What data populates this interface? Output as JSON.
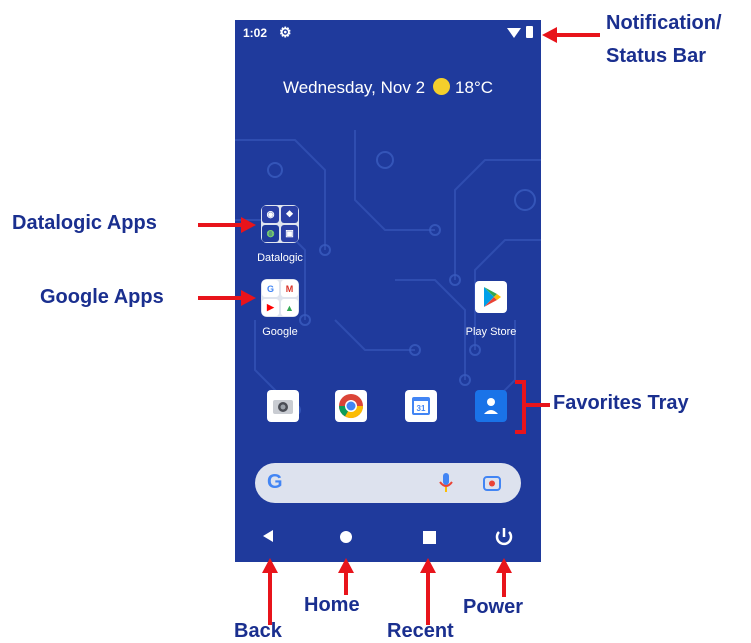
{
  "status_bar": {
    "time": "1:02"
  },
  "date_widget": {
    "date": "Wednesday, Nov 2",
    "temperature": "18°C"
  },
  "home_apps": [
    {
      "label": "Datalogic"
    },
    {
      "label": "Google"
    },
    {
      "label": "Play Store"
    }
  ],
  "favorites": [
    "camera-icon",
    "chrome-icon",
    "calendar-icon",
    "contacts-icon"
  ],
  "calendar_day": "31",
  "nav_buttons": [
    "back-icon",
    "home-icon",
    "recent-icon",
    "power-icon"
  ],
  "callouts": {
    "status_bar_line1": "Notification/",
    "status_bar_line2": "Status Bar",
    "datalogic_apps": "Datalogic Apps",
    "google_apps": "Google Apps",
    "favorites_tray": "Favorites Tray",
    "back": "Back",
    "home": "Home",
    "recent": "Recent",
    "power": "Power"
  },
  "colors": {
    "wallpaper": "#1f3a9c",
    "callout_text": "#1a2f8f",
    "arrow": "#e8141b",
    "sun": "#f4cf2b"
  }
}
